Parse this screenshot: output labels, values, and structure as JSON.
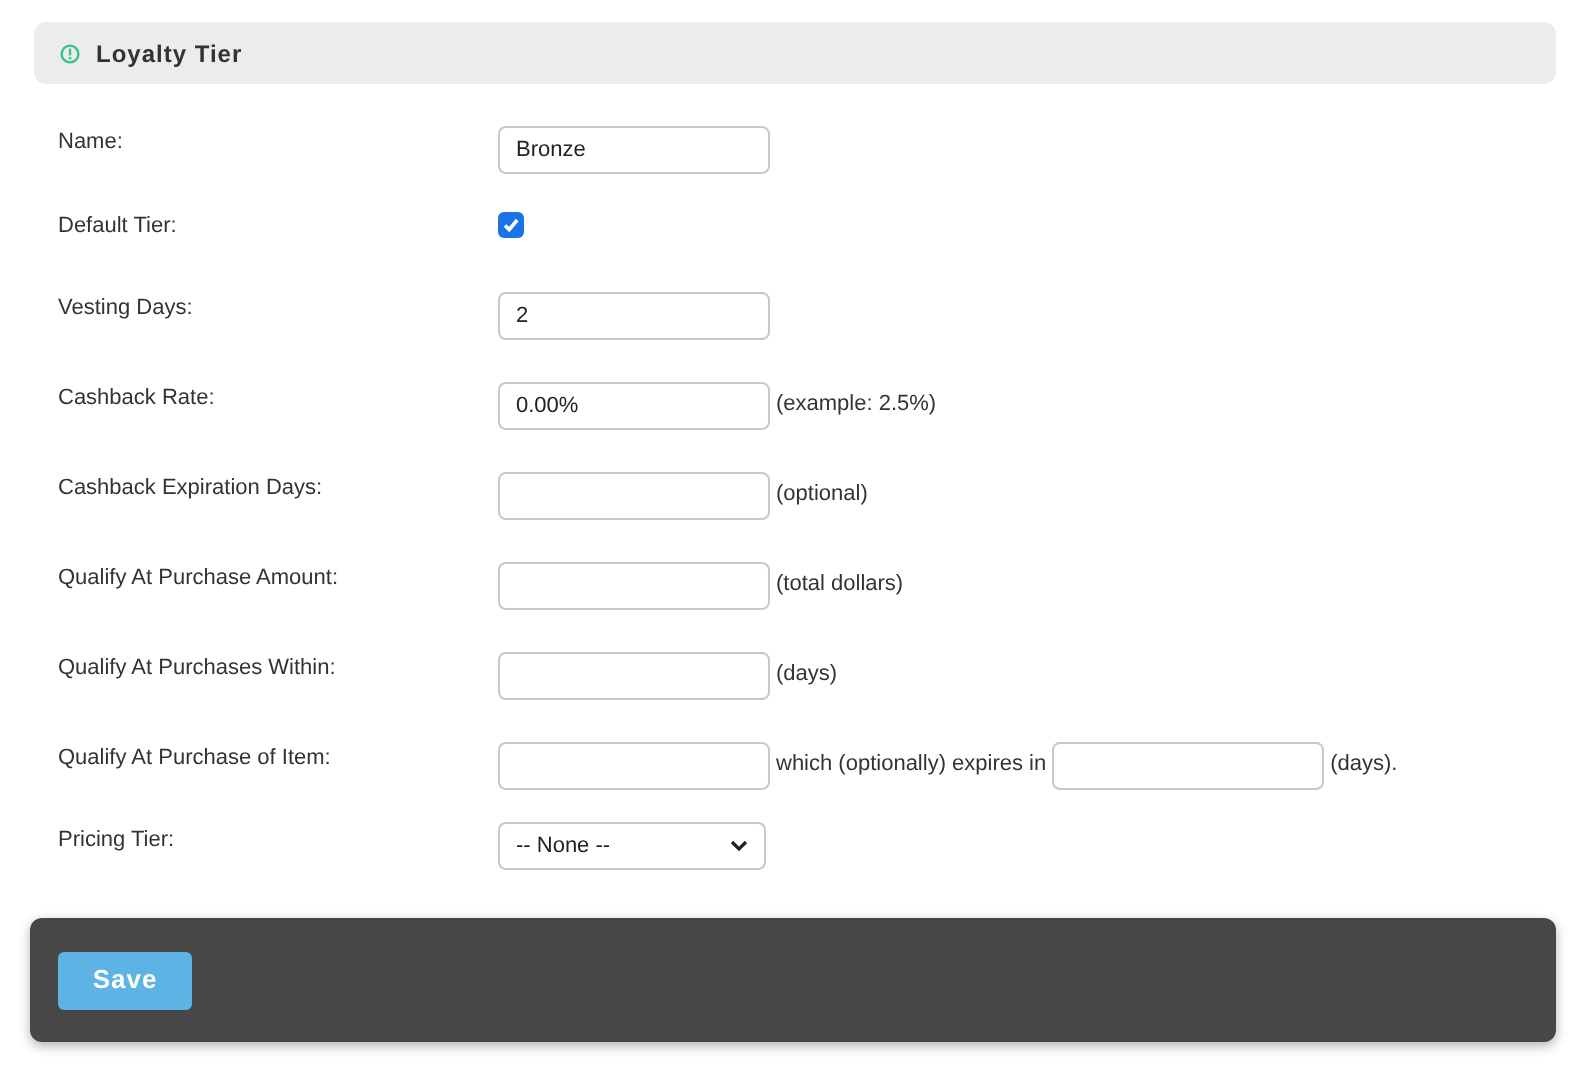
{
  "panel": {
    "title": "Loyalty Tier"
  },
  "rows": [
    {
      "kind": "text",
      "label": "Name:",
      "value": "Bronze"
    },
    {
      "kind": "checkbox",
      "label": "Default Tier:",
      "checked": true
    },
    {
      "kind": "text",
      "label": "Vesting Days:",
      "value": "2"
    },
    {
      "kind": "text",
      "label": "Cashback Rate:",
      "value": "0.00%",
      "note": "(example: 2.5%)"
    },
    {
      "kind": "text",
      "label": "Cashback Expiration Days:",
      "note": "(optional)"
    },
    {
      "kind": "text",
      "label": "Qualify At Purchase Amount:",
      "note": "(total dollars)"
    },
    {
      "kind": "text",
      "label": "Qualify At Purchases Within:",
      "note": "(days)"
    },
    {
      "kind": "item",
      "label": "Qualify At Purchase of Item:",
      "middle": "which (optionally) expires in",
      "note": "(days)."
    },
    {
      "kind": "select",
      "label": "Pricing Tier:",
      "value": "-- None --"
    }
  ],
  "save_button": "Save"
}
